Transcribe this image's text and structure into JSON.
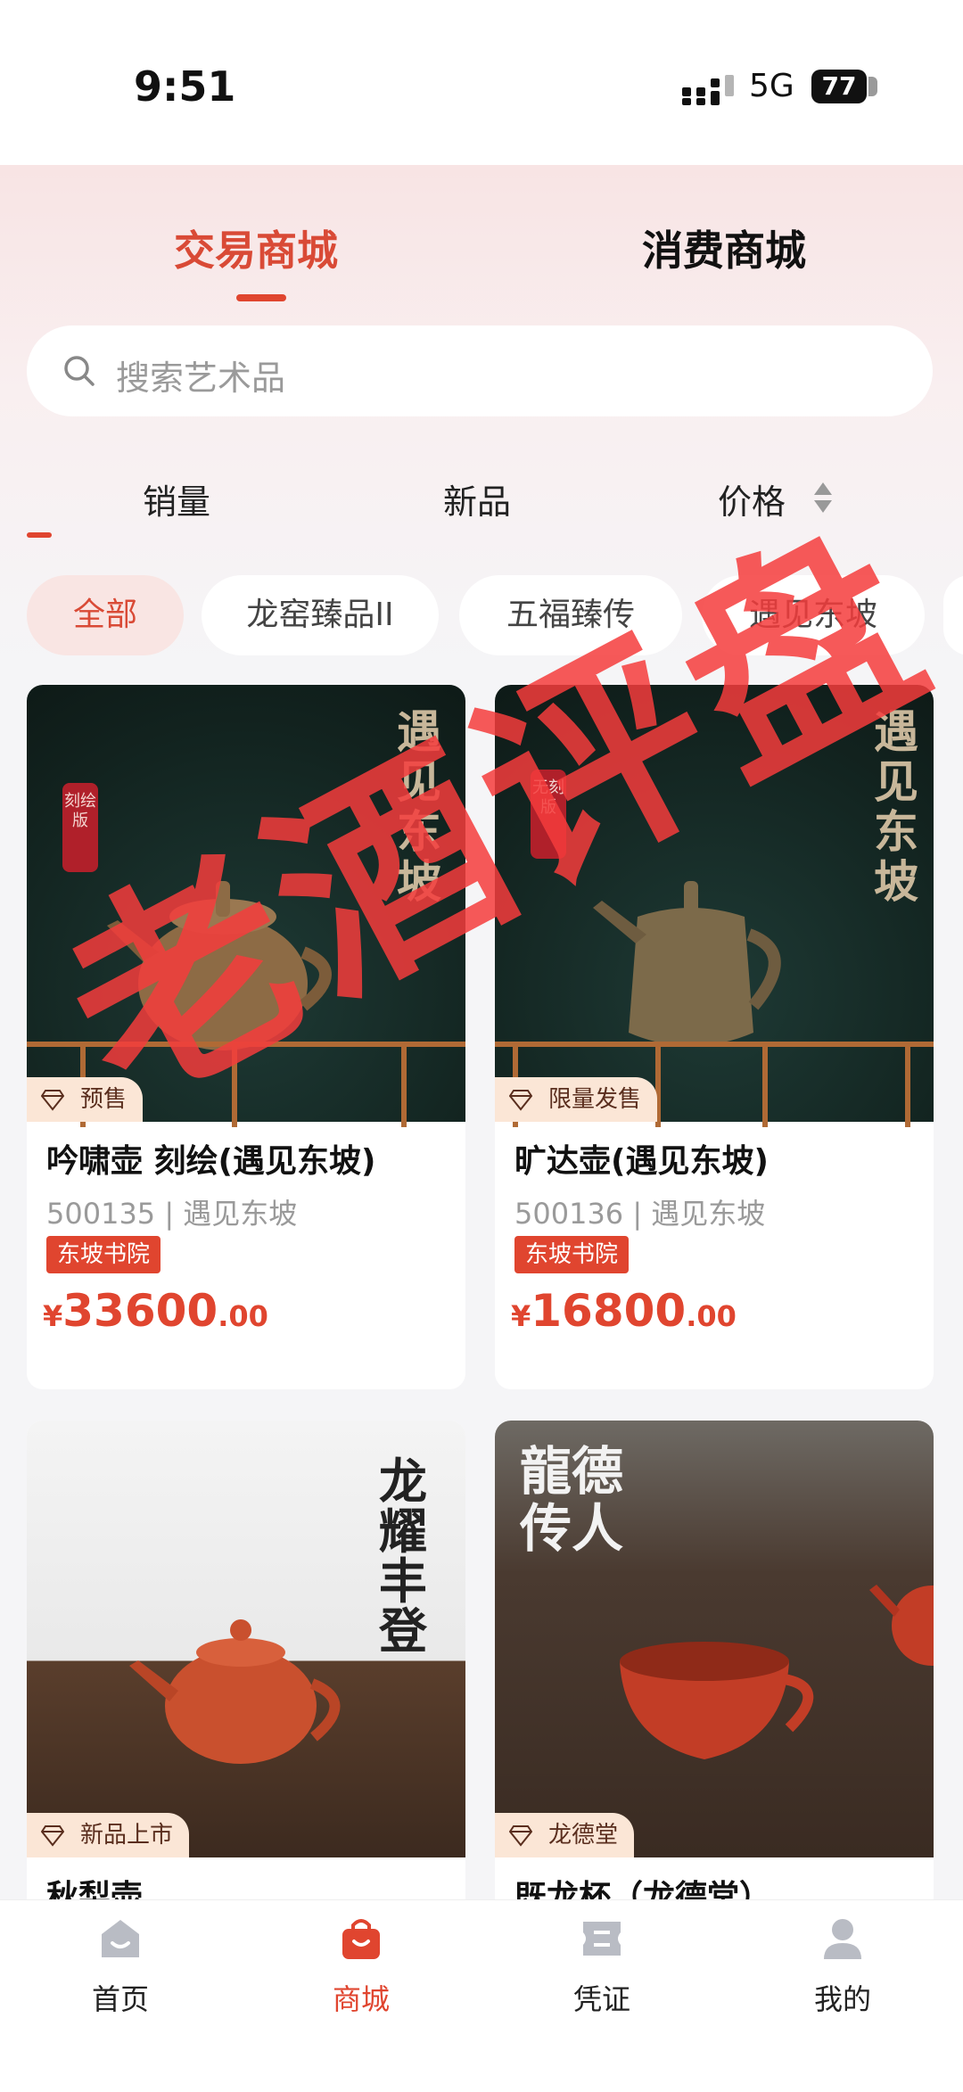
{
  "status": {
    "time": "9:51",
    "network": "5G",
    "battery": "77"
  },
  "tabs": [
    "交易商城",
    "消费商城"
  ],
  "search": {
    "placeholder": "搜索艺术品"
  },
  "sort": [
    "销量",
    "新品",
    "价格"
  ],
  "chips": [
    "全部",
    "龙窑臻品II",
    "五福臻传",
    "遇见东坡"
  ],
  "watermark": "老酒评盘",
  "products": [
    {
      "image_text": "遇见东坡",
      "seal": "刻绘版",
      "badge": "预售",
      "title": "吟啸壶 刻绘(遇见东坡)",
      "meta": "500135 | 遇见东坡",
      "tag": "东坡书院",
      "price": {
        "currency": "¥",
        "integer": "33600",
        "decimal": ".00"
      }
    },
    {
      "image_text": "遇见东坡",
      "seal": "无刻版",
      "badge": "限量发售",
      "title": "旷达壶(遇见东坡)",
      "meta": "500136 | 遇见东坡",
      "tag": "东坡书院",
      "price": {
        "currency": "¥",
        "integer": "16800",
        "decimal": ".00"
      }
    },
    {
      "image_text": "龙耀丰登",
      "badge": "新品上市",
      "title": "秋梨壶"
    },
    {
      "image_text": "龍德传人",
      "badge": "龙德堂",
      "title": "既龙杯（龙德堂）"
    }
  ],
  "nav": [
    {
      "label": "首页",
      "icon": "home-icon",
      "active": false
    },
    {
      "label": "商城",
      "icon": "shopping-bag-icon",
      "active": true
    },
    {
      "label": "凭证",
      "icon": "voucher-icon",
      "active": false
    },
    {
      "label": "我的",
      "icon": "profile-icon",
      "active": false
    }
  ],
  "colors": {
    "accent": "#e0452f",
    "badge_bg": "#fbe6d6",
    "watermark": "#f53c3c"
  }
}
